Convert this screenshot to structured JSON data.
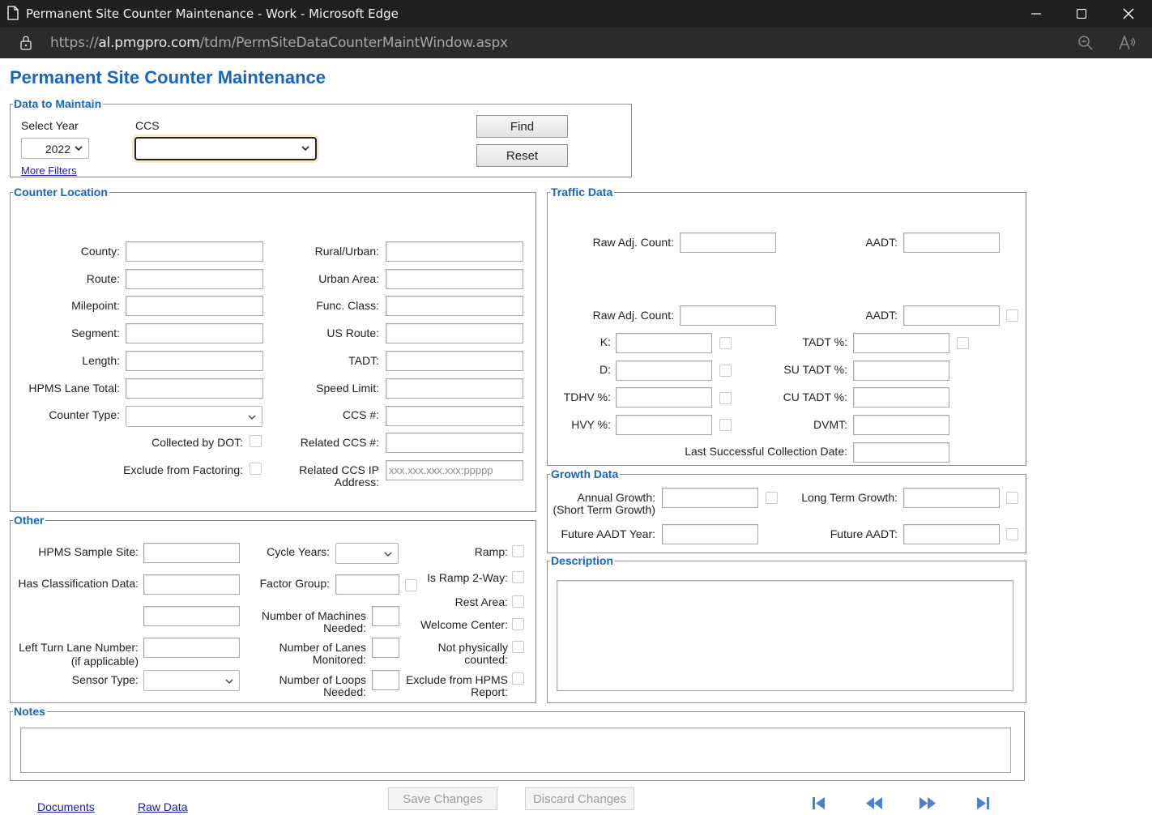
{
  "window": {
    "title": "Permanent Site Counter Maintenance - Work - Microsoft Edge",
    "url_prefix": "https://",
    "url_host": "al.pmgpro.com",
    "url_path": "/tdm/PermSiteDataCounterMaintWindow.aspx"
  },
  "page_title": "Permanent Site Counter Maintenance",
  "data_to_maintain": {
    "legend": "Data to Maintain",
    "select_year_label": "Select Year",
    "select_year_value": "2022",
    "ccs_label": "CCS",
    "ccs_value": "",
    "more_filters": "More Filters",
    "find": "Find",
    "reset": "Reset"
  },
  "counter_location": {
    "legend": "Counter Location",
    "county": "County:",
    "route": "Route:",
    "milepoint": "Milepoint:",
    "segment": "Segment:",
    "length": "Length:",
    "hpms_lane_total": "HPMS Lane Total:",
    "counter_type": "Counter Type:",
    "collected_by_dot": "Collected by DOT:",
    "exclude_from_factoring": "Exclude from Factoring:",
    "rural_urban": "Rural/Urban:",
    "urban_area": "Urban Area:",
    "func_class": "Func. Class:",
    "us_route": "US Route:",
    "tadt": "TADT:",
    "speed_limit": "Speed Limit:",
    "ccs_num": "CCS #:",
    "related_ccs_num": "Related CCS #:",
    "related_ccs_ip_1": "Related CCS IP",
    "related_ccs_ip_2": "Address:",
    "related_ccs_ip_placeholder": "xxx.xxx.xxx.xxx:ppppp"
  },
  "traffic_data": {
    "legend": "Traffic Data",
    "raw_adj_count": "Raw Adj. Count:",
    "aadt": "AADT:",
    "k": "K:",
    "d": "D:",
    "tdhv": "TDHV %:",
    "hvy": "HVY %:",
    "tadt_pct": "TADT %:",
    "su_tadt": "SU TADT %:",
    "cu_tadt": "CU TADT %:",
    "dvmt": "DVMT:",
    "last_collection": "Last Successful Collection Date:"
  },
  "growth_data": {
    "legend": "Growth Data",
    "annual_growth_1": "Annual Growth:",
    "annual_growth_2": "(Short Term Growth)",
    "long_term_growth": "Long Term Growth:",
    "future_aadt_year": "Future AADT Year:",
    "future_aadt": "Future AADT:"
  },
  "other": {
    "legend": "Other",
    "hpms_sample_site": "HPMS Sample Site:",
    "has_classification": "Has Classification Data:",
    "left_turn_1": "Left Turn Lane Number:",
    "left_turn_2": "(if applicable)",
    "sensor_type": "Sensor Type:",
    "cycle_years": "Cycle Years:",
    "factor_group": "Factor Group:",
    "machines_1": "Number of Machines",
    "machines_2": "Needed:",
    "lanes_1": "Number of Lanes",
    "lanes_2": "Monitored:",
    "loops_1": "Number of Loops",
    "loops_2": "Needed:",
    "ramp": "Ramp:",
    "ramp_2way": "Is Ramp 2-Way:",
    "rest_area": "Rest Area:",
    "welcome_center": "Welcome Center:",
    "not_counted_1": "Not physically",
    "not_counted_2": "counted:",
    "exclude_hpms_1": "Exclude from HPMS",
    "exclude_hpms_2": "Report:"
  },
  "description": {
    "legend": "Description"
  },
  "notes": {
    "legend": "Notes"
  },
  "footer": {
    "documents": "Documents",
    "raw_data": "Raw Data",
    "save_changes": "Save Changes",
    "discard_changes": "Discard Changes"
  },
  "colors": {
    "accent": "#1565c0",
    "link": "#1a1aa6",
    "nav": "#4a7fd6"
  }
}
